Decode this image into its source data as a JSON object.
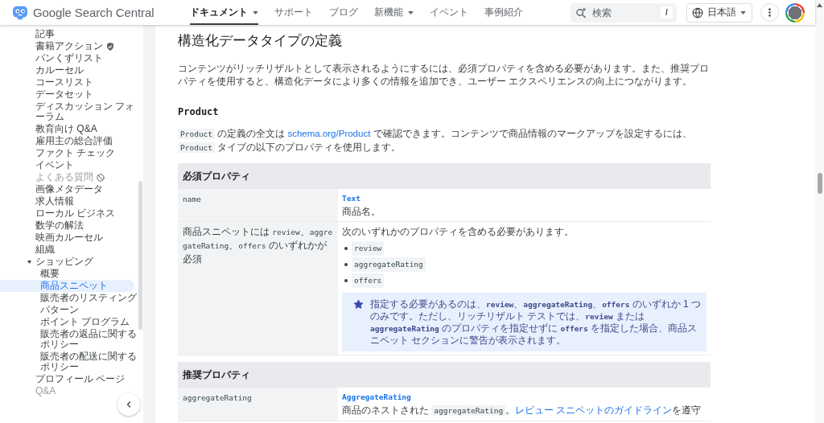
{
  "header": {
    "brand": "Google Search Central",
    "nav": [
      {
        "label": "ドキュメント",
        "selected": true,
        "has_menu": true
      },
      {
        "label": "サポート",
        "selected": false,
        "has_menu": false
      },
      {
        "label": "ブログ",
        "selected": false,
        "has_menu": false
      },
      {
        "label": "新機能",
        "selected": false,
        "has_menu": true
      },
      {
        "label": "イベント",
        "selected": false,
        "has_menu": false
      },
      {
        "label": "事例紹介",
        "selected": false,
        "has_menu": false
      }
    ],
    "search": {
      "placeholder": "検索",
      "shortcut": "/"
    },
    "language": "日本語"
  },
  "sidebar": {
    "items": [
      {
        "label": "記事",
        "kind": "plain",
        "selected": false,
        "dimmed": false
      },
      {
        "label": "書籍アクション",
        "kind": "verified",
        "selected": false,
        "dimmed": false
      },
      {
        "label": "パンくずリスト",
        "kind": "plain",
        "selected": false,
        "dimmed": false
      },
      {
        "label": "カルーセル",
        "kind": "plain",
        "selected": false,
        "dimmed": false
      },
      {
        "label": "コースリスト",
        "kind": "plain",
        "selected": false,
        "dimmed": false
      },
      {
        "label": "データセット",
        "kind": "plain",
        "selected": false,
        "dimmed": false
      },
      {
        "label": "ディスカッション フォーラム",
        "kind": "plain",
        "selected": false,
        "dimmed": false
      },
      {
        "label": "教育向け Q&A",
        "kind": "plain",
        "selected": false,
        "dimmed": false
      },
      {
        "label": "雇用主の総合評価",
        "kind": "plain",
        "selected": false,
        "dimmed": false
      },
      {
        "label": "ファクト チェック",
        "kind": "plain",
        "selected": false,
        "dimmed": false
      },
      {
        "label": "イベント",
        "kind": "plain",
        "selected": false,
        "dimmed": false
      },
      {
        "label": "よくある質問",
        "kind": "deprecated",
        "selected": false,
        "dimmed": true
      },
      {
        "label": "画像メタデータ",
        "kind": "plain",
        "selected": false,
        "dimmed": false
      },
      {
        "label": "求人情報",
        "kind": "plain",
        "selected": false,
        "dimmed": false
      },
      {
        "label": "ローカル ビジネス",
        "kind": "plain",
        "selected": false,
        "dimmed": false
      },
      {
        "label": "数学の解法",
        "kind": "plain",
        "selected": false,
        "dimmed": false
      },
      {
        "label": "映画カルーセル",
        "kind": "plain",
        "selected": false,
        "dimmed": false
      },
      {
        "label": "組織",
        "kind": "plain",
        "selected": false,
        "dimmed": false
      },
      {
        "label": "ショッピング",
        "kind": "group",
        "selected": false,
        "dimmed": false,
        "expanded": true,
        "children": [
          {
            "label": "概要",
            "selected": false,
            "dimmed": false
          },
          {
            "label": "商品スニペット",
            "selected": true,
            "dimmed": false
          },
          {
            "label": "販売者のリスティング",
            "selected": false,
            "dimmed": false
          },
          {
            "label": "パターン",
            "selected": false,
            "dimmed": false
          },
          {
            "label": "ポイント プログラム",
            "selected": false,
            "dimmed": false
          },
          {
            "label": "販売者の返品に関するポリシー",
            "selected": false,
            "dimmed": false
          },
          {
            "label": "販売者の配送に関するポリシー",
            "selected": false,
            "dimmed": false
          }
        ]
      },
      {
        "label": "プロフィール ページ",
        "kind": "plain",
        "selected": false,
        "dimmed": false
      },
      {
        "label": "Q&A",
        "kind": "plain",
        "selected": false,
        "dimmed": true
      }
    ]
  },
  "content": {
    "title": "構造化データタイプの定義",
    "intro": "コンテンツがリッチリザルトとして表示されるようにするには、必須プロパティを含める必要があります。また、推奨プロパティを使用すると、構造化データにより多くの情報を追加でき、ユーザー エクスペリエンスの向上につながります。",
    "section_title": "Product",
    "section_text": [
      {
        "kind": "code",
        "text": "Product"
      },
      {
        "kind": "text",
        "text": " の定義の全文は "
      },
      {
        "kind": "link",
        "text": "schema.org/Product"
      },
      {
        "kind": "text",
        "text": " で確認できます。コンテンツで商品情報のマークアップを設定するには、"
      },
      {
        "kind": "code",
        "text": "Product"
      },
      {
        "kind": "text",
        "text": " タイプの以下のプロパティを使用します。"
      }
    ],
    "tables": [
      {
        "heading": "必須プロパティ",
        "rows": [
          {
            "property": [
              {
                "kind": "code",
                "text": "name"
              }
            ],
            "details": [
              {
                "kind": "type",
                "text": "Text"
              },
              {
                "kind": "paragraph",
                "parts": [
                  {
                    "kind": "text",
                    "text": "商品名。"
                  }
                ]
              }
            ]
          },
          {
            "property": [
              {
                "kind": "text",
                "text": "商品スニペットには "
              },
              {
                "kind": "code",
                "text": "review"
              },
              {
                "kind": "text",
                "text": "、"
              },
              {
                "kind": "code",
                "text": "aggregateRating"
              },
              {
                "kind": "text",
                "text": "、"
              },
              {
                "kind": "code",
                "text": "offers"
              },
              {
                "kind": "text",
                "text": " のいずれかが必須"
              }
            ],
            "details": [
              {
                "kind": "paragraph",
                "parts": [
                  {
                    "kind": "text",
                    "text": "次のいずれかのプロパティを含める必要があります。"
                  }
                ]
              },
              {
                "kind": "list",
                "items": [
                  "review",
                  "aggregateRating",
                  "offers"
                ]
              },
              {
                "kind": "note",
                "text": "指定する必要があるのは、**review**、**aggregateRating**、**offers** のいずれか 1 つのみです。ただし、リッチリザルト テストでは、**review** または **aggregateRating** のプロパティを指定せずに **offers** を指定した場合、商品スニペット セクションに警告が表示されます。"
              }
            ]
          }
        ]
      },
      {
        "heading": "推奨プロパティ",
        "rows": [
          {
            "property": [
              {
                "kind": "code",
                "text": "aggregateRating"
              }
            ],
            "details": [
              {
                "kind": "type",
                "text": "AggregateRating"
              },
              {
                "kind": "paragraph",
                "parts": [
                  {
                    "kind": "text",
                    "text": "商品のネストされた "
                  },
                  {
                    "kind": "code",
                    "text": "aggregateRating"
                  },
                  {
                    "kind": "text",
                    "text": "。"
                  },
                  {
                    "kind": "link",
                    "text": "レビュー スニペットのガイドライン"
                  },
                  {
                    "kind": "text",
                    "text": "を遵守"
                  }
                ]
              }
            ]
          }
        ]
      }
    ]
  }
}
